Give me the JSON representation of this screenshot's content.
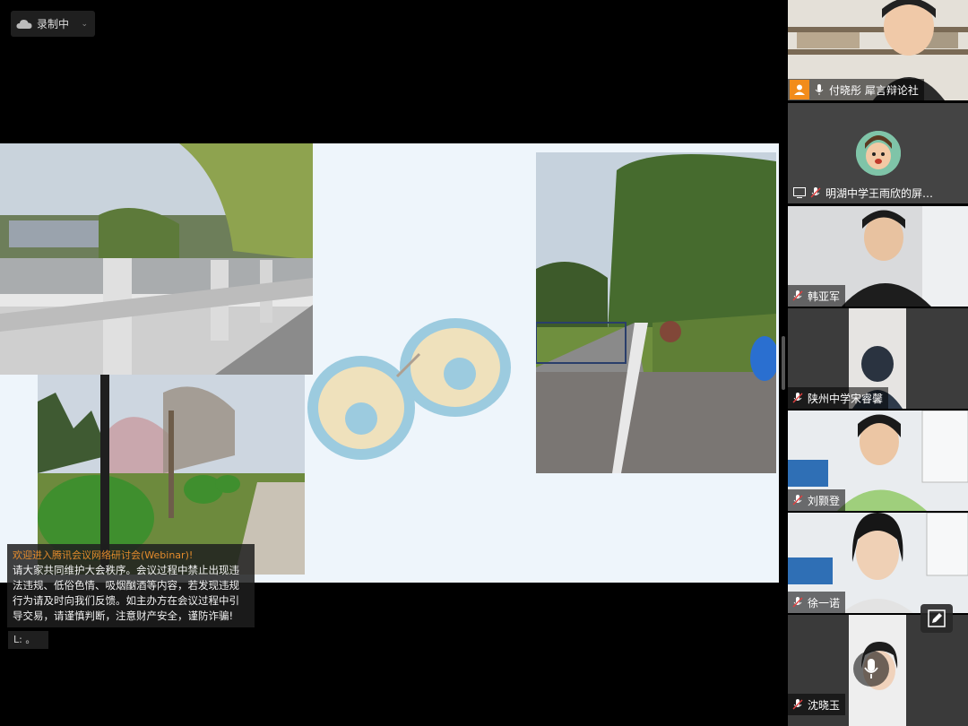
{
  "recording": {
    "label": "录制中"
  },
  "notice": {
    "title": "欢迎进入腾讯会议网络研讨会(Webinar)!",
    "body": "请大家共同维护大会秩序。会议过程中禁止出现违法违规、低俗色情、吸烟酗酒等内容，若发现违规行为请及时向我们反馈。如主办方在会议过程中引导交易，请谨慎判断，注意财产安全，谨防诈骗!"
  },
  "chat": {
    "line": "L: 。"
  },
  "participants": [
    {
      "name": "付晓彤  犀言辩论社",
      "role": "host"
    },
    {
      "name": "明湖中学王雨欣的屏…",
      "role": "screen-share"
    },
    {
      "name": "韩亚军",
      "role": "muted"
    },
    {
      "name": "陕州中学宋睿馨",
      "role": "muted"
    },
    {
      "name": "刘颢登",
      "role": "muted"
    },
    {
      "name": "徐一诺",
      "role": "muted"
    },
    {
      "name": "沈晓玉",
      "role": "muted"
    }
  ],
  "colors": {
    "host_badge": "#f28c1b",
    "notice_title": "#e38b2c",
    "slide_bg": "#eef5fb"
  }
}
